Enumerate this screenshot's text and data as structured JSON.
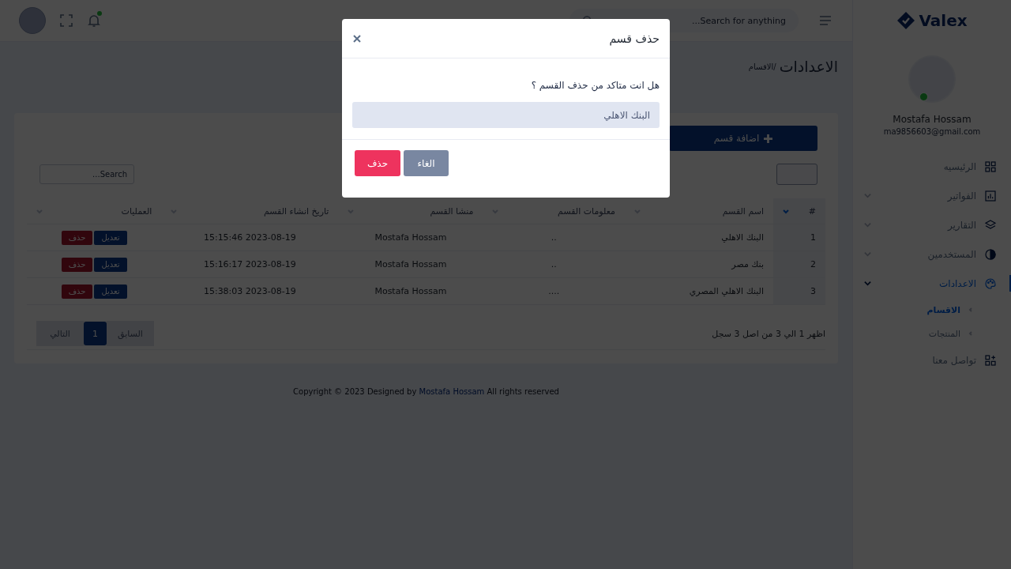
{
  "header": {
    "search_placeholder": "Search for anything...",
    "notifications_unread": true
  },
  "sidebar": {
    "logo": "Valex",
    "user": {
      "name": "Mostafa Hossam",
      "email": "ma9856603@gmail.com",
      "online": true
    },
    "items": [
      {
        "label": "الرئيسيه",
        "has_submenu": false,
        "selected": false
      },
      {
        "label": "الفواتير",
        "has_submenu": true,
        "selected": false
      },
      {
        "label": "التقارير",
        "has_submenu": true,
        "selected": false
      },
      {
        "label": "المستخدمين",
        "has_submenu": true,
        "selected": false
      },
      {
        "label": "الاعدادات",
        "has_submenu": true,
        "selected": true,
        "children": [
          {
            "label": "الاقسام",
            "selected": true
          },
          {
            "label": "المنتجات",
            "selected": false
          }
        ]
      },
      {
        "label": "تواصل معنا",
        "has_submenu": false,
        "selected": false
      }
    ]
  },
  "page": {
    "title": "الاعدادات",
    "breadcrumb": "/الاقسام"
  },
  "card": {
    "add_button": "اضافة قسم",
    "search_placeholder": "Search...",
    "table": {
      "columns": [
        {
          "label": "#",
          "sorted": true
        },
        {
          "label": "اسم القسم",
          "sorted": false
        },
        {
          "label": "معلومات القسم",
          "sorted": false
        },
        {
          "label": "منشا القسم",
          "sorted": false
        },
        {
          "label": "تاريخ انشاء القسم",
          "sorted": false
        },
        {
          "label": "العمليات",
          "sorted": false
        }
      ],
      "rows": [
        {
          "cells": [
            "1",
            "البنك الاهلي",
            "..",
            "Mostafa Hossam",
            "2023-08-19 15:15:46"
          ],
          "actions": [
            {
              "label": "تعديل",
              "kind": "edit"
            },
            {
              "label": "حذف",
              "kind": "delete"
            }
          ]
        },
        {
          "cells": [
            "2",
            "بنك مصر",
            "..",
            "Mostafa Hossam",
            "2023-08-19 15:16:17"
          ],
          "actions": [
            {
              "label": "تعديل",
              "kind": "edit"
            },
            {
              "label": "حذف",
              "kind": "delete"
            }
          ]
        },
        {
          "cells": [
            "3",
            "البنك الاهلي المصري",
            "....",
            "Mostafa Hossam",
            "2023-08-19 15:38:03"
          ],
          "actions": [
            {
              "label": "تعديل",
              "kind": "edit"
            },
            {
              "label": "حذف",
              "kind": "delete"
            }
          ]
        }
      ]
    },
    "info": "اظهر 1 الي 3 من اصل 3 سجل",
    "pagination": [
      {
        "label": "السابق",
        "selected": false,
        "disabled": true
      },
      {
        "label": "1",
        "selected": true,
        "disabled": false
      },
      {
        "label": "التالي",
        "selected": false,
        "disabled": true
      }
    ]
  },
  "footer": {
    "before": "Copyright © 2023 Designed by",
    "link": "Mostafa Hossam",
    "after": "All rights reserved"
  },
  "modal": {
    "open": true,
    "title": "حذف قسم",
    "message": "هل انت متاكد من حذف القسم ؟",
    "value": "البنك الاهلي",
    "buttons": [
      {
        "label": "الغاء",
        "kind": "secondary"
      },
      {
        "label": "حذف",
        "kind": "danger"
      }
    ]
  }
}
